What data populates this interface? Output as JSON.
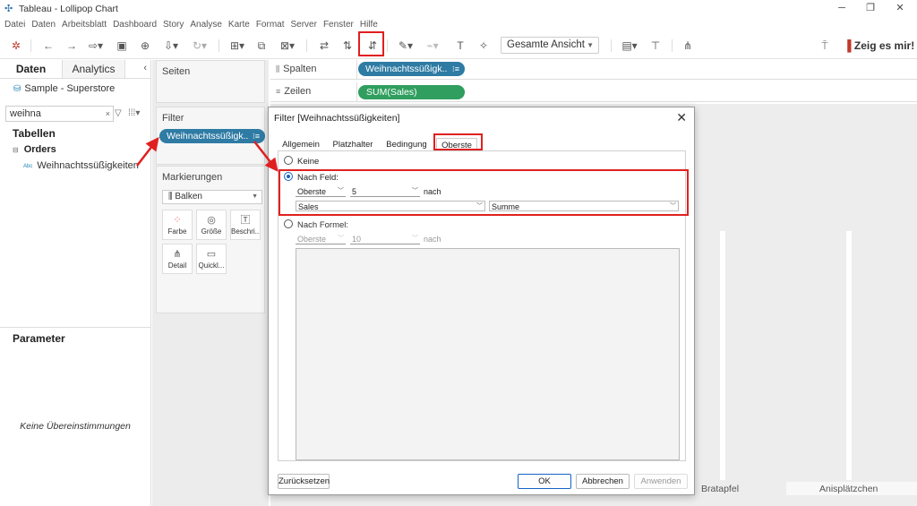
{
  "window": {
    "title": "Tableau - Lollipop Chart",
    "minimize": "─",
    "restore": "❐",
    "close": "✕"
  },
  "menu": [
    "Datei",
    "Daten",
    "Arbeitsblatt",
    "Dashboard",
    "Story",
    "Analyse",
    "Karte",
    "Format",
    "Server",
    "Fenster",
    "Hilfe"
  ],
  "toolbar": {
    "view_mode": "Gesamte Ansicht",
    "show_me": "Zeig es mir!"
  },
  "data_pane": {
    "tabs": [
      "Daten",
      "Analytics"
    ],
    "collapse": "‹",
    "data_source": "Sample - Superstore",
    "search_value": "weihna",
    "search_clear": "×",
    "tables_heading": "Tabellen",
    "table": "Orders",
    "field": "Weihnachtssüßigkeiten",
    "field_type": "Abc",
    "parameters_heading": "Parameter",
    "no_matches": "Keine Übereinstimmungen"
  },
  "cards": {
    "pages": "Seiten",
    "filters": "Filter",
    "filter_pill": "Weihnachtssüßigk..",
    "marks": "Markierungen",
    "mark_type": "Balken",
    "mark_buttons": [
      "Farbe",
      "Größe",
      "Beschri...",
      "Detail",
      "Quickl..."
    ]
  },
  "shelves": {
    "columns_label": "Spalten",
    "columns_pill": "Weihnachtssüßigk..",
    "rows_label": "Zeilen",
    "rows_pill": "SUM(Sales)"
  },
  "view": {
    "x_labels": [
      "Bratapfel",
      "Anisplätzchen"
    ]
  },
  "dialog": {
    "title": "Filter [Weihnachtssüßigkeiten]",
    "close": "✕",
    "tabs": [
      "Allgemein",
      "Platzhalter",
      "Bedingung",
      "Oberste"
    ],
    "active_tab": "Oberste",
    "option_none": "Keine",
    "option_by_field": "Nach Feld:",
    "by_field": {
      "direction": "Oberste",
      "count": "5",
      "by_text": "nach",
      "field": "Sales",
      "aggregation": "Summe"
    },
    "option_by_formula": "Nach Formel:",
    "by_formula": {
      "direction": "Oberste",
      "count": "10",
      "by_text": "nach"
    },
    "buttons": {
      "reset": "Zurücksetzen",
      "ok": "OK",
      "cancel": "Abbrechen",
      "apply": "Anwenden"
    }
  },
  "colors": {
    "annotation": "#e02020",
    "pill_blue": "#2e7ba4",
    "pill_green": "#2f9e5e",
    "radio_selected": "#1463c7"
  }
}
